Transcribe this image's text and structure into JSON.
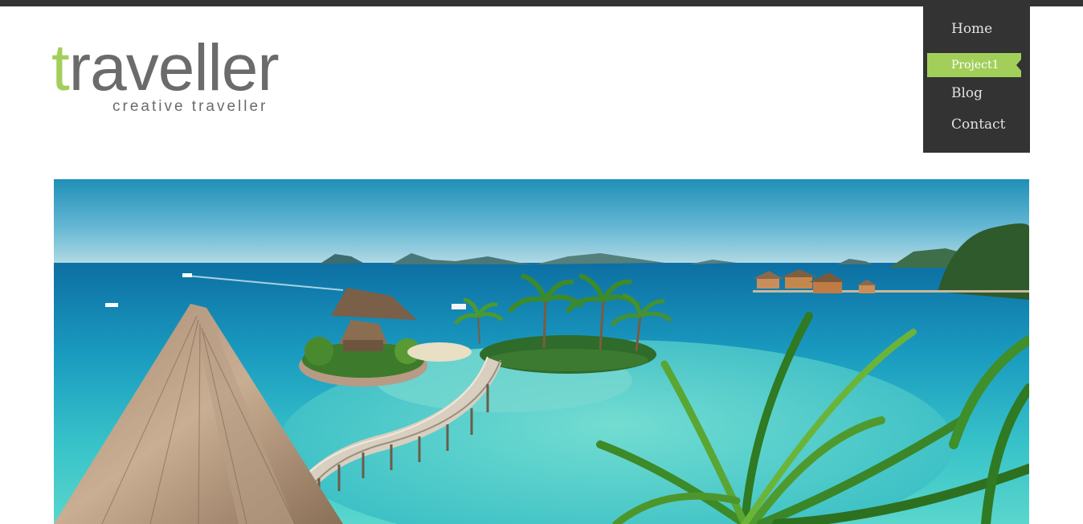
{
  "logo": {
    "first_letter": "t",
    "rest": "raveller",
    "tagline": "creative traveller"
  },
  "nav": {
    "items": [
      {
        "label": "Home",
        "active": false
      },
      {
        "label": "Project1",
        "active": true
      },
      {
        "label": "Blog",
        "active": false
      },
      {
        "label": "Contact",
        "active": false
      }
    ]
  },
  "colors": {
    "accent": "#a2cf5a",
    "dark": "#333333",
    "logo_gray": "#6b6b6b",
    "nav_text": "#e2e2e2"
  }
}
